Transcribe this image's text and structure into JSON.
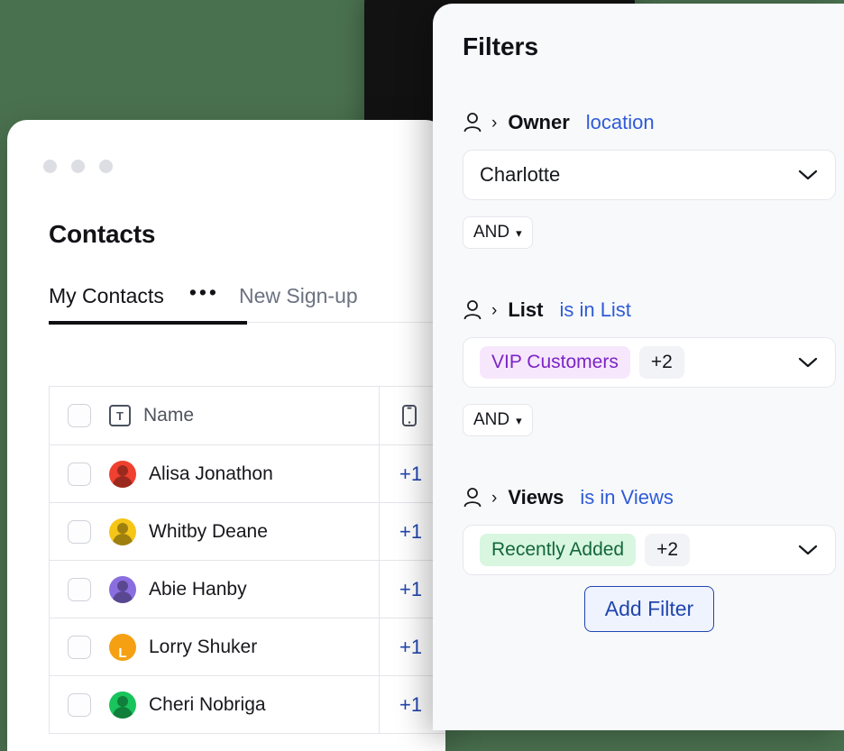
{
  "background": {
    "color": "#4a714f",
    "backdrop_card_color": "#121212"
  },
  "contacts_window": {
    "title": "Contacts",
    "window_dots": [
      "dot",
      "dot",
      "dot"
    ],
    "tabs": [
      {
        "label": "My Contacts",
        "active": true
      },
      {
        "label": "•••",
        "active": false
      },
      {
        "label": "New Sign-up",
        "active": false
      }
    ],
    "table": {
      "columns": [
        {
          "key": "check",
          "label": "",
          "icon": "checkbox-icon"
        },
        {
          "key": "name",
          "label": "Name",
          "icon": "text-type-icon"
        },
        {
          "key": "phone",
          "label": "",
          "icon": "mobile-phone-icon"
        }
      ],
      "rows": [
        {
          "name": "Alisa Jonathon",
          "phone": "+1",
          "avatar_color": "#f0402f",
          "avatar_initial": ""
        },
        {
          "name": "Whitby Deane",
          "phone": "+1",
          "avatar_color": "#f5c518",
          "avatar_initial": ""
        },
        {
          "name": "Abie Hanby",
          "phone": "+1",
          "avatar_color": "#8a6ee0",
          "avatar_initial": ""
        },
        {
          "name": "Lorry Shuker",
          "phone": "+1",
          "avatar_color": "#f5a013",
          "avatar_initial": "L"
        },
        {
          "name": "Cheri Nobriga",
          "phone": "+1",
          "avatar_color": "#19c45c",
          "avatar_initial": ""
        }
      ]
    }
  },
  "filters": {
    "title": "Filters",
    "add_filter_label": "Add Filter",
    "accent_blue": "#2146ad",
    "groups": [
      {
        "icon": "person-icon",
        "separator": "›",
        "field": "Owner",
        "operator": "location",
        "value": "Charlotte",
        "chips": [],
        "count_chip": "",
        "connector": "AND"
      },
      {
        "icon": "person-icon",
        "separator": "›",
        "field": "List",
        "operator": "is in List",
        "value": "",
        "chips": [
          {
            "label": "VIP Customers",
            "style": "purple"
          }
        ],
        "count_chip": "+2",
        "connector": "AND"
      },
      {
        "icon": "person-icon",
        "separator": "›",
        "field": "Views",
        "operator": "is in Views",
        "value": "",
        "chips": [
          {
            "label": "Recently Added",
            "style": "green"
          }
        ],
        "count_chip": "+2",
        "connector": ""
      }
    ]
  }
}
